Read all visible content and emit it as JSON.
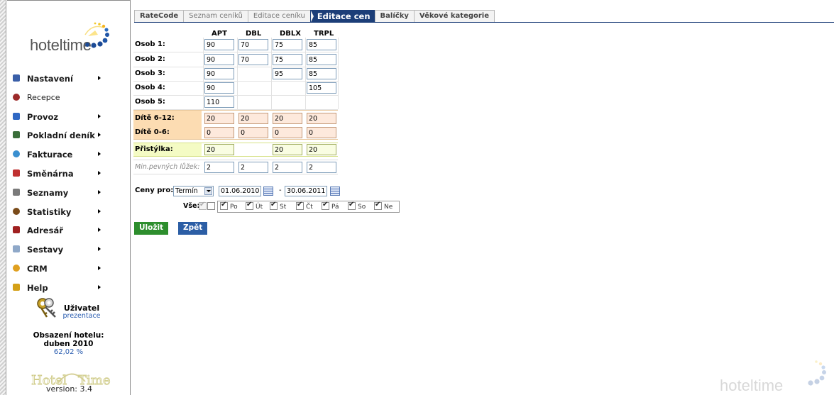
{
  "logo": {
    "wordmark": "hoteltime"
  },
  "menu": [
    {
      "label": "Nastavení",
      "icon": "settings-icon",
      "submenu": true
    },
    {
      "label": "Recepce",
      "icon": "reception-icon",
      "submenu": false
    },
    {
      "label": "Provoz",
      "icon": "operation-icon",
      "submenu": true
    },
    {
      "label": "Pokladní deník",
      "icon": "cashbook-icon",
      "submenu": true
    },
    {
      "label": "Fakturace",
      "icon": "invoice-icon",
      "submenu": true
    },
    {
      "label": "Směnárna",
      "icon": "exchange-icon",
      "submenu": true
    },
    {
      "label": "Seznamy",
      "icon": "lists-icon",
      "submenu": true
    },
    {
      "label": "Statistiky",
      "icon": "statistics-icon",
      "submenu": true
    },
    {
      "label": "Adresář",
      "icon": "address-book-icon",
      "submenu": true
    },
    {
      "label": "Sestavy",
      "icon": "reports-icon",
      "submenu": true
    },
    {
      "label": "CRM",
      "icon": "crm-icon",
      "submenu": true
    },
    {
      "label": "Help",
      "icon": "help-icon",
      "submenu": true
    }
  ],
  "user": {
    "title": "Uživatel",
    "name": "prezentace"
  },
  "occupancy": {
    "title": "Obsazení hotelu:",
    "month": "duben 2010",
    "value": "62,02 %"
  },
  "version": "version: 3.4",
  "tabs": [
    {
      "label": "RateCode",
      "state": "bold"
    },
    {
      "label": "Seznam ceníků",
      "state": "muted"
    },
    {
      "label": "Editace ceníku",
      "state": "muted"
    },
    {
      "label": "Editace cen",
      "state": "active"
    },
    {
      "label": "Balíčky",
      "state": "bold"
    },
    {
      "label": "Věkové kategorie",
      "state": "bold"
    }
  ],
  "rate_table": {
    "columns": [
      "APT",
      "DBL",
      "DBLX",
      "TRPL"
    ],
    "rows": [
      {
        "label": "Osob 1:",
        "values": [
          "90",
          "70",
          "75",
          "85"
        ]
      },
      {
        "label": "Osob 2:",
        "values": [
          "90",
          "70",
          "75",
          "85"
        ]
      },
      {
        "label": "Osob 3:",
        "values": [
          "90",
          null,
          "95",
          "85"
        ]
      },
      {
        "label": "Osob 4:",
        "values": [
          "90",
          null,
          null,
          "105"
        ]
      },
      {
        "label": "Osob 5:",
        "values": [
          "110",
          null,
          null,
          null
        ]
      },
      {
        "label": "Dítě 6-12:",
        "values": [
          "20",
          "20",
          "20",
          "20"
        ]
      },
      {
        "label": "Dítě 0-6:",
        "values": [
          "0",
          "0",
          "0",
          "0"
        ]
      },
      {
        "label": "Přistýlka:",
        "values": [
          "20",
          null,
          "20",
          "20"
        ]
      },
      {
        "label": "Min.pevných lůžek:",
        "values": [
          "2",
          "2",
          "2",
          "2"
        ]
      }
    ]
  },
  "prices_for": {
    "label": "Ceny pro:",
    "mode": "Termín",
    "date_from": "01.06.2010",
    "separator": "-",
    "date_to": "30.06.2011"
  },
  "days": {
    "all_label": "Vše:",
    "items": [
      {
        "label": "Po",
        "checked": true
      },
      {
        "label": "Út",
        "checked": true
      },
      {
        "label": "St",
        "checked": true
      },
      {
        "label": "Čt",
        "checked": true
      },
      {
        "label": "Pá",
        "checked": true
      },
      {
        "label": "So",
        "checked": true
      },
      {
        "label": "Ne",
        "checked": true
      }
    ]
  },
  "buttons": {
    "save": "Uložit",
    "back": "Zpět"
  },
  "colors": {
    "save": "#2d8e2d",
    "back": "#2c5ea5",
    "active_tab": "#1c3e78",
    "kids_band": "#fcdcb2",
    "extra_band": "#f4fbc4"
  }
}
